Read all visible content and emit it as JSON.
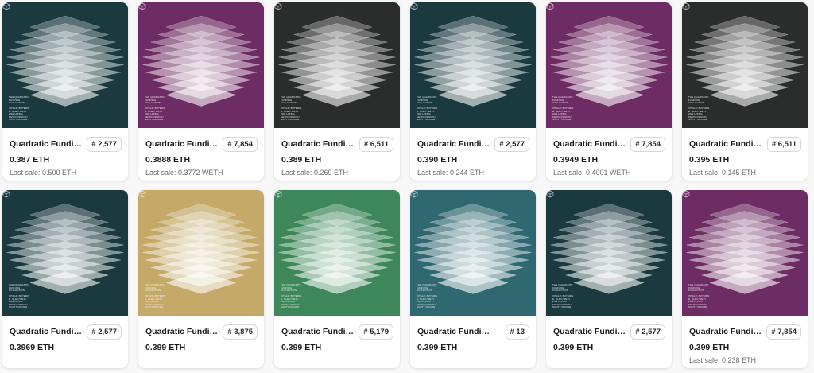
{
  "listing": {
    "items": [
      {
        "name": "Quadratic Funding Open Edition",
        "token": "# 2,577",
        "price": "0.387 ETH",
        "last_sale": "Last sale: 0.500 ETH",
        "bg": "#1b3a3f"
      },
      {
        "name": "Quadratic Funding Open Edition",
        "token": "# 7,854",
        "price": "0.3888 ETH",
        "last_sale": "Last sale: 0.3772 WETH",
        "bg": "#6e2c64"
      },
      {
        "name": "Quadratic Funding Open Edition",
        "token": "# 6,511",
        "price": "0.389 ETH",
        "last_sale": "Last sale: 0.269 ETH",
        "bg": "#2b2d2c"
      },
      {
        "name": "Quadratic Funding Open Edition",
        "token": "# 2,577",
        "price": "0.390 ETH",
        "last_sale": "Last sale: 0.244 ETH",
        "bg": "#1b3a3f"
      },
      {
        "name": "Quadratic Funding Open Edition",
        "token": "# 7,854",
        "price": "0.3949 ETH",
        "last_sale": "Last sale: 0.4001 WETH",
        "bg": "#6e2c64"
      },
      {
        "name": "Quadratic Funding Open Edition",
        "token": "# 6,511",
        "price": "0.395 ETH",
        "last_sale": "Last sale: 0.145 ETH",
        "bg": "#2b2d2c"
      },
      {
        "name": "Quadratic Funding Open Edition",
        "token": "# 2,577",
        "price": "0.3969 ETH",
        "last_sale": "",
        "bg": "#1b3a3f"
      },
      {
        "name": "Quadratic Funding Open Edition",
        "token": "# 3,875",
        "price": "0.399 ETH",
        "last_sale": "",
        "bg": "#c4a968"
      },
      {
        "name": "Quadratic Funding Open Edition",
        "token": "# 5,179",
        "price": "0.399 ETH",
        "last_sale": "",
        "bg": "#3e875b"
      },
      {
        "name": "Quadratic Funding Open Edition",
        "token": "# 13",
        "price": "0.399 ETH",
        "last_sale": "",
        "bg": "#306872"
      },
      {
        "name": "Quadratic Funding Open Edition",
        "token": "# 2,577",
        "price": "0.399 ETH",
        "last_sale": "",
        "bg": "#1b3a3f"
      },
      {
        "name": "Quadratic Funding Open Edition",
        "token": "# 7,854",
        "price": "0.399 ETH",
        "last_sale": "Last sale: 0.238 ETH",
        "bg": "#6e2c64"
      }
    ],
    "art_text": {
      "title_lines": [
        "THE QUADRATIC",
        "FUNDING",
        "COLLECTION"
      ],
      "author_lines": [
        "VITALIK BUTERIN",
        "E. GLEN WEYL",
        "ZOË HITZIG",
        "KEVIN OWOCKI",
        "SCOTT MOORE"
      ]
    }
  }
}
